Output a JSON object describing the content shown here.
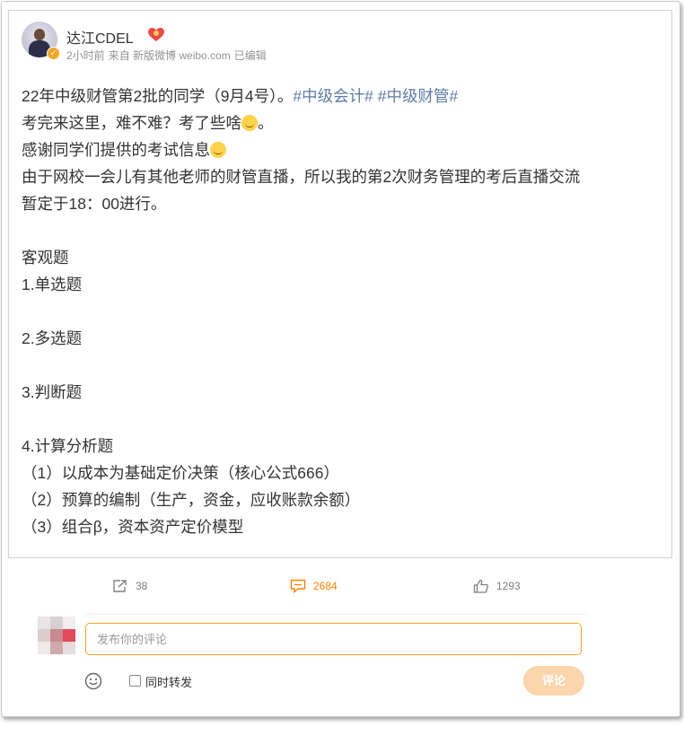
{
  "post": {
    "author": "达江CDEL",
    "meta": {
      "time": "2小时前",
      "source": "来自 新版微博 weibo.com",
      "edited": "已编辑"
    },
    "lines": [
      {
        "text": "22年中级财管第2批的同学（9月4号）。",
        "tags": [
          "#中级会计#",
          "#中级财管#"
        ]
      },
      {
        "text": "考完来这里，难不难？考了些啥",
        "suffix": "。",
        "emoji": "smile-emoji"
      },
      {
        "text": "感谢同学们提供的考试信息",
        "emoji": "kiss-emoji"
      },
      {
        "text": "由于网校一会儿有其他老师的财管直播，所以我的第2次财务管理的考后直播交流"
      },
      {
        "text": "暂定于18：00进行。"
      },
      {
        "text": ""
      },
      {
        "text": "客观题"
      },
      {
        "text": "1.单选题"
      },
      {
        "text": ""
      },
      {
        "text": "2.多选题"
      },
      {
        "text": ""
      },
      {
        "text": "3.判断题"
      },
      {
        "text": ""
      },
      {
        "text": "4.计算分析题"
      },
      {
        "text": "（1）以成本为基础定价决策（核心公式666）"
      },
      {
        "text": "（2）预算的编制（生产，资金，应收账款余额）"
      },
      {
        "text": "（3）组合β，资本资产定价模型"
      }
    ]
  },
  "actions": {
    "share_count": "38",
    "comment_count": "2684",
    "like_count": "1293"
  },
  "comment_box": {
    "placeholder": "发布你的评论",
    "repost_label": "同时转发",
    "submit_label": "评论"
  },
  "colors": {
    "tag": "#5d7ba4",
    "accent": "#ff8200",
    "submit_bg": "#fbd5ab"
  }
}
